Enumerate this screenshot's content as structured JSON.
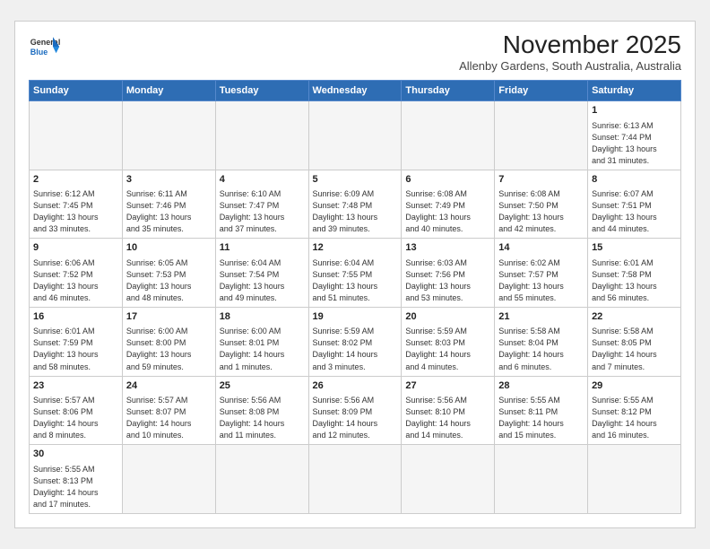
{
  "header": {
    "logo_general": "General",
    "logo_blue": "Blue",
    "month": "November 2025",
    "location": "Allenby Gardens, South Australia, Australia"
  },
  "weekdays": [
    "Sunday",
    "Monday",
    "Tuesday",
    "Wednesday",
    "Thursday",
    "Friday",
    "Saturday"
  ],
  "weeks": [
    [
      {
        "day": "",
        "info": ""
      },
      {
        "day": "",
        "info": ""
      },
      {
        "day": "",
        "info": ""
      },
      {
        "day": "",
        "info": ""
      },
      {
        "day": "",
        "info": ""
      },
      {
        "day": "",
        "info": ""
      },
      {
        "day": "1",
        "info": "Sunrise: 6:13 AM\nSunset: 7:44 PM\nDaylight: 13 hours\nand 31 minutes."
      }
    ],
    [
      {
        "day": "2",
        "info": "Sunrise: 6:12 AM\nSunset: 7:45 PM\nDaylight: 13 hours\nand 33 minutes."
      },
      {
        "day": "3",
        "info": "Sunrise: 6:11 AM\nSunset: 7:46 PM\nDaylight: 13 hours\nand 35 minutes."
      },
      {
        "day": "4",
        "info": "Sunrise: 6:10 AM\nSunset: 7:47 PM\nDaylight: 13 hours\nand 37 minutes."
      },
      {
        "day": "5",
        "info": "Sunrise: 6:09 AM\nSunset: 7:48 PM\nDaylight: 13 hours\nand 39 minutes."
      },
      {
        "day": "6",
        "info": "Sunrise: 6:08 AM\nSunset: 7:49 PM\nDaylight: 13 hours\nand 40 minutes."
      },
      {
        "day": "7",
        "info": "Sunrise: 6:08 AM\nSunset: 7:50 PM\nDaylight: 13 hours\nand 42 minutes."
      },
      {
        "day": "8",
        "info": "Sunrise: 6:07 AM\nSunset: 7:51 PM\nDaylight: 13 hours\nand 44 minutes."
      }
    ],
    [
      {
        "day": "9",
        "info": "Sunrise: 6:06 AM\nSunset: 7:52 PM\nDaylight: 13 hours\nand 46 minutes."
      },
      {
        "day": "10",
        "info": "Sunrise: 6:05 AM\nSunset: 7:53 PM\nDaylight: 13 hours\nand 48 minutes."
      },
      {
        "day": "11",
        "info": "Sunrise: 6:04 AM\nSunset: 7:54 PM\nDaylight: 13 hours\nand 49 minutes."
      },
      {
        "day": "12",
        "info": "Sunrise: 6:04 AM\nSunset: 7:55 PM\nDaylight: 13 hours\nand 51 minutes."
      },
      {
        "day": "13",
        "info": "Sunrise: 6:03 AM\nSunset: 7:56 PM\nDaylight: 13 hours\nand 53 minutes."
      },
      {
        "day": "14",
        "info": "Sunrise: 6:02 AM\nSunset: 7:57 PM\nDaylight: 13 hours\nand 55 minutes."
      },
      {
        "day": "15",
        "info": "Sunrise: 6:01 AM\nSunset: 7:58 PM\nDaylight: 13 hours\nand 56 minutes."
      }
    ],
    [
      {
        "day": "16",
        "info": "Sunrise: 6:01 AM\nSunset: 7:59 PM\nDaylight: 13 hours\nand 58 minutes."
      },
      {
        "day": "17",
        "info": "Sunrise: 6:00 AM\nSunset: 8:00 PM\nDaylight: 13 hours\nand 59 minutes."
      },
      {
        "day": "18",
        "info": "Sunrise: 6:00 AM\nSunset: 8:01 PM\nDaylight: 14 hours\nand 1 minutes."
      },
      {
        "day": "19",
        "info": "Sunrise: 5:59 AM\nSunset: 8:02 PM\nDaylight: 14 hours\nand 3 minutes."
      },
      {
        "day": "20",
        "info": "Sunrise: 5:59 AM\nSunset: 8:03 PM\nDaylight: 14 hours\nand 4 minutes."
      },
      {
        "day": "21",
        "info": "Sunrise: 5:58 AM\nSunset: 8:04 PM\nDaylight: 14 hours\nand 6 minutes."
      },
      {
        "day": "22",
        "info": "Sunrise: 5:58 AM\nSunset: 8:05 PM\nDaylight: 14 hours\nand 7 minutes."
      }
    ],
    [
      {
        "day": "23",
        "info": "Sunrise: 5:57 AM\nSunset: 8:06 PM\nDaylight: 14 hours\nand 8 minutes."
      },
      {
        "day": "24",
        "info": "Sunrise: 5:57 AM\nSunset: 8:07 PM\nDaylight: 14 hours\nand 10 minutes."
      },
      {
        "day": "25",
        "info": "Sunrise: 5:56 AM\nSunset: 8:08 PM\nDaylight: 14 hours\nand 11 minutes."
      },
      {
        "day": "26",
        "info": "Sunrise: 5:56 AM\nSunset: 8:09 PM\nDaylight: 14 hours\nand 12 minutes."
      },
      {
        "day": "27",
        "info": "Sunrise: 5:56 AM\nSunset: 8:10 PM\nDaylight: 14 hours\nand 14 minutes."
      },
      {
        "day": "28",
        "info": "Sunrise: 5:55 AM\nSunset: 8:11 PM\nDaylight: 14 hours\nand 15 minutes."
      },
      {
        "day": "29",
        "info": "Sunrise: 5:55 AM\nSunset: 8:12 PM\nDaylight: 14 hours\nand 16 minutes."
      }
    ],
    [
      {
        "day": "30",
        "info": "Sunrise: 5:55 AM\nSunset: 8:13 PM\nDaylight: 14 hours\nand 17 minutes."
      },
      {
        "day": "",
        "info": ""
      },
      {
        "day": "",
        "info": ""
      },
      {
        "day": "",
        "info": ""
      },
      {
        "day": "",
        "info": ""
      },
      {
        "day": "",
        "info": ""
      },
      {
        "day": "",
        "info": ""
      }
    ]
  ]
}
